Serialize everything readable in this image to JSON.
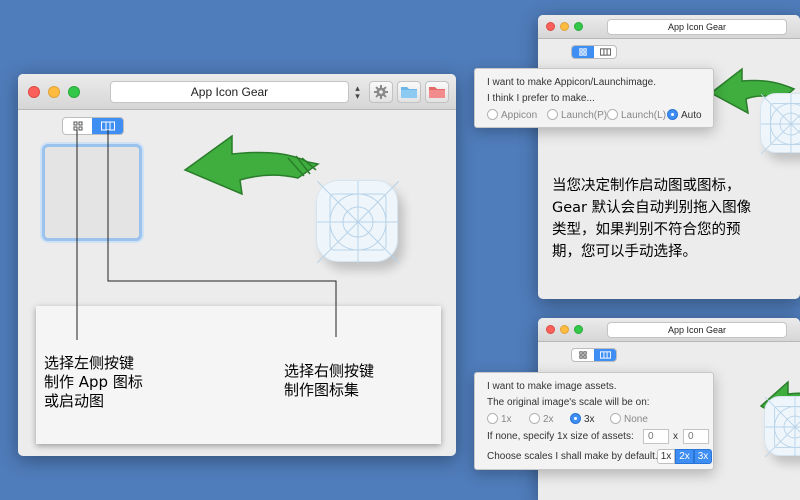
{
  "app_title": "App Icon Gear",
  "main_window": {
    "title": "App Icon Gear"
  },
  "top_right_window": {
    "title": "App Icon Gear",
    "prompt_1": "I want to make Appicon/Launchimage.",
    "prompt_2": "I think I prefer to make...",
    "options": [
      "Appicon",
      "Launch(P)",
      "Launch(L)",
      "Auto"
    ],
    "selected": "Auto",
    "note": "当您决定制作启动图或图标，Gear 默认会自动判别拖入图像类型，如果判别不符合您的预期，您可以手动选择。",
    "note_lines": [
      "当您决定制作启动图或图标，",
      "Gear 默认会自动判别拖入图像",
      "类型，如果判别不符合您的预",
      "期，您可以手动选择。"
    ]
  },
  "bottom_right_window": {
    "title": "App Icon Gear",
    "prompt_1": "I want to make image assets.",
    "prompt_2": "The original image's scale will be on:",
    "scale_options": [
      "1x",
      "2x",
      "3x",
      "None"
    ],
    "selected_scale": "3x",
    "size_label": "If none, specify 1x size of assets:",
    "size_width": "0",
    "size_x": "x",
    "size_height": "0",
    "make_label": "Choose scales I shall make by default.",
    "make_scales": [
      "1x",
      "2x",
      "3x"
    ],
    "make_selected": [
      "2x",
      "3x"
    ]
  },
  "annotation": {
    "left_label_lines": [
      "选择左侧按键",
      "制作 App 图标",
      "或启动图"
    ],
    "right_label_lines": [
      "选择右侧按键",
      "制作图标集"
    ]
  },
  "colors": {
    "background": "#4f7cba",
    "accent": "#3f8ef3",
    "arrow": "#3fae3f"
  },
  "icons": [
    "gear-icon",
    "folder-icon",
    "folder-red-icon",
    "grid-icon",
    "imageset-icon",
    "app-icon-template"
  ]
}
